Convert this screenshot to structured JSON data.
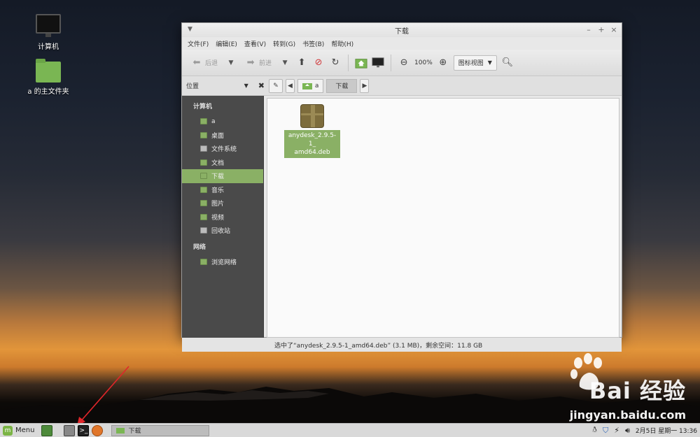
{
  "desktop": {
    "icons": [
      {
        "label": "计算机",
        "icon": "computer-monitor-icon"
      },
      {
        "label": "a 的主文件夹",
        "icon": "home-folder-icon"
      }
    ]
  },
  "window": {
    "title": "下载",
    "controls": {
      "minimize": "–",
      "maximize": "+",
      "close": "×"
    },
    "menu": [
      "文件(F)",
      "编辑(E)",
      "查看(V)",
      "转到(G)",
      "书签(B)",
      "帮助(H)"
    ],
    "toolbar": {
      "back_label": "后退",
      "forward_label": "前进",
      "zoom_level": "100%",
      "view_mode": "图标视图"
    },
    "location": {
      "places_label": "位置",
      "crumbs": [
        "a",
        "下载"
      ]
    },
    "sidebar": {
      "computer_heading": "计算机",
      "computer_items": [
        "a",
        "桌面",
        "文件系统",
        "文档",
        "下载",
        "音乐",
        "图片",
        "视频",
        "回收站"
      ],
      "selected": "下载",
      "network_heading": "网络",
      "network_items": [
        "浏览网络"
      ]
    },
    "files": [
      {
        "name_line1": "anydesk_2.9.5-1_",
        "name_line2": "amd64.deb",
        "selected": true
      }
    ],
    "status": "选中了“anydesk_2.9.5-1_amd64.deb” (3.1 MB)，剩余空间：11.8 GB"
  },
  "watermark": {
    "brand": "Bai 经验",
    "url": "jingyan.baidu.com"
  },
  "taskbar": {
    "menu_label": "Menu",
    "task_window": "下载",
    "clock": "2月5日 星期一 13:36"
  },
  "colors": {
    "accent": "#8ab065",
    "sidebar_bg": "#4a4a4a",
    "arrow": "#e0262a"
  }
}
